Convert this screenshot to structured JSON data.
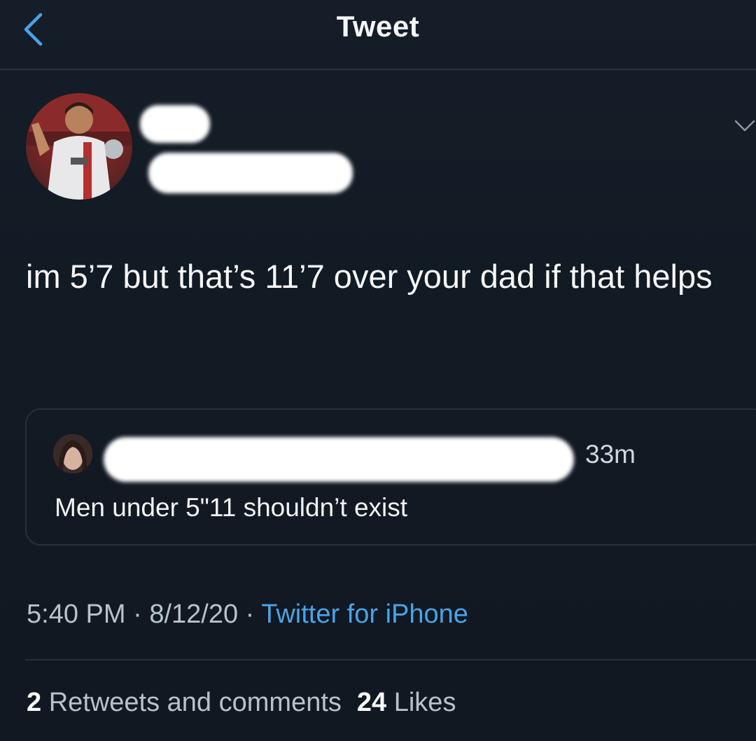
{
  "header": {
    "title": "Tweet",
    "back_icon": "chevron-left-icon"
  },
  "colors": {
    "background": "#121a24",
    "accent": "#4aa3e8",
    "divider": "#27313c"
  },
  "tweet": {
    "text": "im 5’7 but that’s 11’7 over your dad if that helps",
    "menu_icon": "chevron-down-icon"
  },
  "quoted_tweet": {
    "time": "33m",
    "text": "Men under 5\"11 shouldn’t exist"
  },
  "meta": {
    "time": "5:40 PM",
    "separator": "·",
    "date": "8/12/20",
    "source": "Twitter for iPhone"
  },
  "stats": {
    "retweets_count": "2",
    "retweets_label": "Retweets and comments",
    "likes_count": "24",
    "likes_label": "Likes"
  }
}
